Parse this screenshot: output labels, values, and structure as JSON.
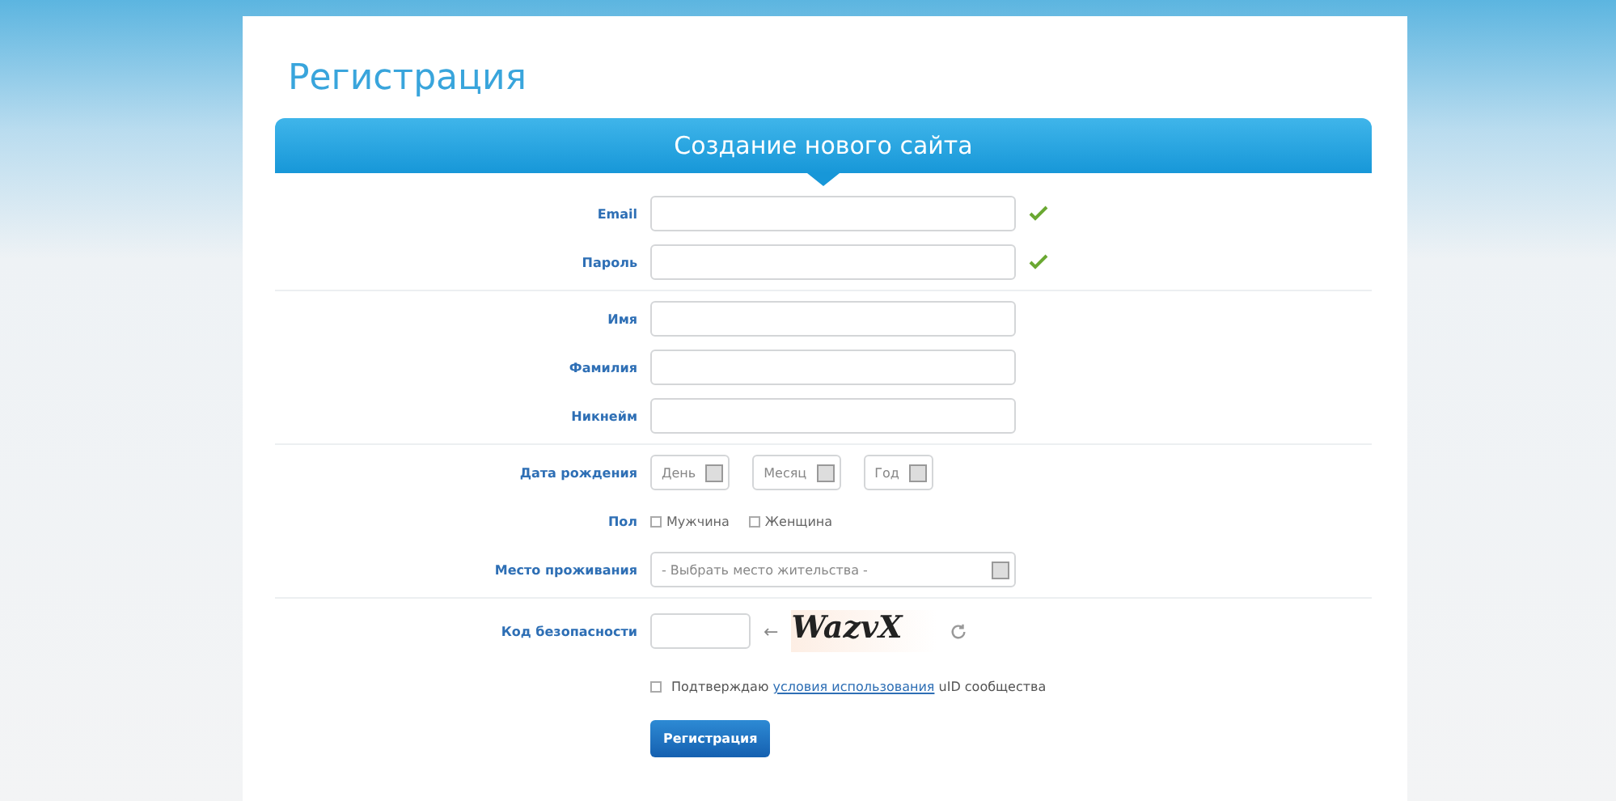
{
  "page": {
    "title": "Регистрация"
  },
  "form": {
    "header": "Создание нового сайта",
    "groups": [
      [
        {
          "label": "Email",
          "valid": true
        },
        {
          "label": "Пароль",
          "valid": true
        }
      ],
      [
        {
          "label": "Имя",
          "valid": false
        },
        {
          "label": "Фамилия",
          "valid": false
        },
        {
          "label": "Никнейм",
          "valid": false
        }
      ]
    ],
    "birth_date": {
      "label": "Дата рождения",
      "selects": [
        "День",
        "Месяц",
        "Год"
      ]
    },
    "gender": {
      "label": "Пол",
      "options": [
        {
          "label": "Мужчина",
          "selected": false
        },
        {
          "label": "Женщина",
          "selected": false
        }
      ]
    },
    "residence": {
      "label": "Место проживания",
      "value": "- Выбрать место жительства -"
    },
    "captcha": {
      "label": "Код безопасности",
      "arrow": "←",
      "code": "WazvX"
    },
    "terms": {
      "checked": false,
      "before": "Подтверждаю",
      "link": "условия использования",
      "after": "uID сообщества"
    },
    "submit": "Регистрация"
  }
}
